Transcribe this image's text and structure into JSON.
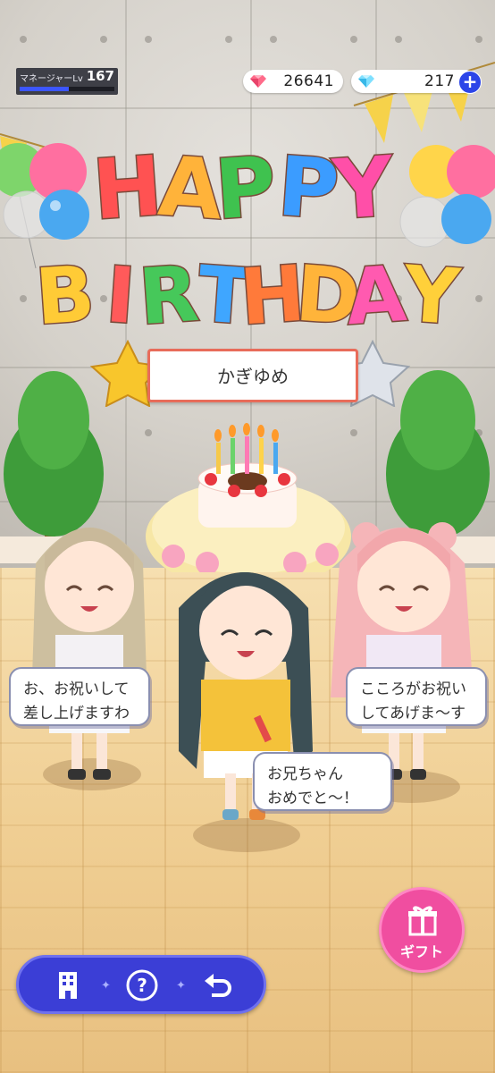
{
  "hud": {
    "manager_label": "マネージャーLv",
    "manager_level": "167",
    "exp_progress": 0.52,
    "paid_gems": "26641",
    "free_gems": "217",
    "plus_icon": "plus-icon"
  },
  "title": {
    "line1": "HAPPY",
    "line2": "BIRTHDAY",
    "letter_colors": [
      "#ff5252",
      "#ffb33a",
      "#3fc24f",
      "#3b9cff",
      "#ff4fa8",
      "#ffcb36",
      "#ff5a5a",
      "#46c85a",
      "#3fa6ff",
      "#ff7a3a",
      "#ffb43a",
      "#ff5ab0",
      "#ffd03a"
    ]
  },
  "birthday_name": "かぎゆめ",
  "speech": {
    "left": [
      "お、お祝いして",
      "差し上げますわ"
    ],
    "right": [
      "こころがお祝い",
      "してあげま～す"
    ],
    "center": [
      "お兄ちゃん",
      "おめでと～！"
    ]
  },
  "nav": {
    "home_icon": "building-icon",
    "help_icon": "question-icon",
    "back_icon": "back-arrow-icon"
  },
  "gift": {
    "label": "ギフト",
    "icon": "gift-icon"
  },
  "colors": {
    "nav_bg": "#3b3ed6",
    "gift_bg": "#f04ea0",
    "accent_blue": "#2c45e8"
  }
}
